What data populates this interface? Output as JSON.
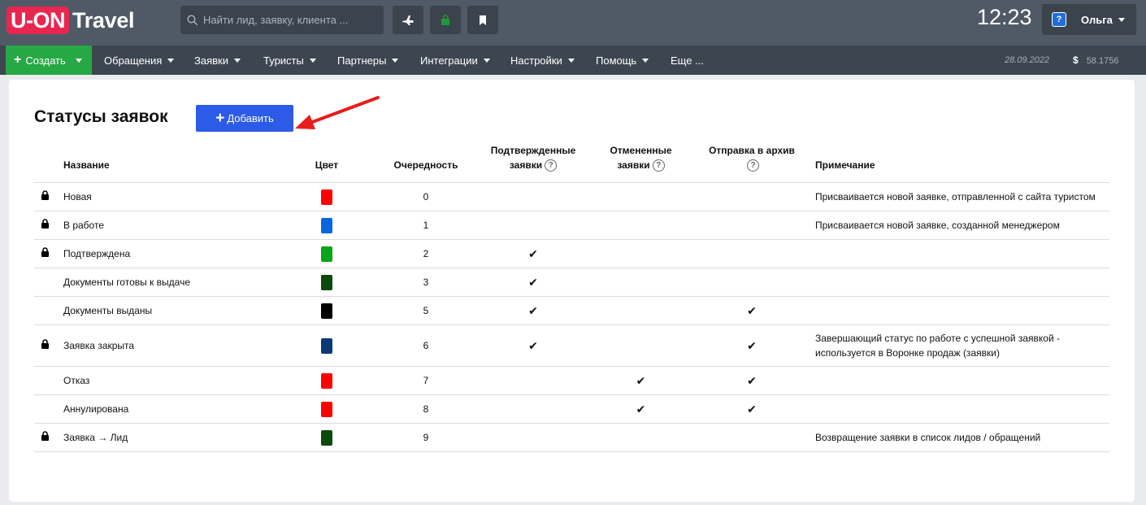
{
  "header": {
    "logo_box": "U-ON",
    "logo_text": "Travel",
    "search_placeholder": "Найти лид, заявку, клиента ...",
    "clock": "12:23",
    "user_name": "Ольга"
  },
  "nav": {
    "create": "Создать",
    "items": [
      "Обращения",
      "Заявки",
      "Туристы",
      "Партнеры",
      "Интеграции",
      "Настройки",
      "Помощь",
      "Еще ..."
    ],
    "date": "28.09.2022",
    "currency_symbol": "$",
    "rate": "58.1756"
  },
  "page": {
    "title": "Статусы заявок",
    "add_label": "Добавить"
  },
  "table": {
    "headers": {
      "name": "Название",
      "color": "Цвет",
      "order": "Очередность",
      "confirmed_1": "Подтвержденные",
      "confirmed_2": "заявки",
      "cancelled_1": "Отмененные",
      "cancelled_2": "заявки",
      "archive": "Отправка в архив",
      "note": "Примечание"
    },
    "rows": [
      {
        "locked": true,
        "name": "Новая",
        "color": "#ff0000",
        "order": "0",
        "confirmed": false,
        "cancelled": false,
        "archive": false,
        "note": "Присваивается новой заявке, отправленной с сайта туристом"
      },
      {
        "locked": true,
        "name": "В работе",
        "color": "#0a66e0",
        "order": "1",
        "confirmed": false,
        "cancelled": false,
        "archive": false,
        "note": "Присваивается новой заявке, созданной менеджером"
      },
      {
        "locked": true,
        "name": "Подтверждена",
        "color": "#09a41a",
        "order": "2",
        "confirmed": true,
        "cancelled": false,
        "archive": false,
        "note": ""
      },
      {
        "locked": false,
        "name": "Документы готовы к выдаче",
        "color": "#0b4a0b",
        "order": "3",
        "confirmed": true,
        "cancelled": false,
        "archive": false,
        "note": ""
      },
      {
        "locked": false,
        "name": "Документы выданы",
        "color": "#000000",
        "order": "5",
        "confirmed": true,
        "cancelled": false,
        "archive": true,
        "note": ""
      },
      {
        "locked": true,
        "name": "Заявка закрыта",
        "color": "#0a3a75",
        "order": "6",
        "confirmed": true,
        "cancelled": false,
        "archive": true,
        "note": "Завершающий статус по работе с успешной заявкой - используется в Воронке продаж (заявки)"
      },
      {
        "locked": false,
        "name": "Отказ",
        "color": "#ff0000",
        "order": "7",
        "confirmed": false,
        "cancelled": true,
        "archive": true,
        "note": ""
      },
      {
        "locked": false,
        "name": "Аннулирована",
        "color": "#ff0000",
        "order": "8",
        "confirmed": false,
        "cancelled": true,
        "archive": true,
        "note": ""
      },
      {
        "locked": true,
        "name": "Заявка → Лид",
        "color": "#0b4a0b",
        "order": "9",
        "confirmed": false,
        "cancelled": false,
        "archive": false,
        "note": "Возвращение заявки в список лидов / обращений"
      }
    ]
  },
  "colors": {
    "create_green": "#26a844",
    "add_blue": "#2c5be8",
    "arrow_red": "#e81c1c"
  }
}
